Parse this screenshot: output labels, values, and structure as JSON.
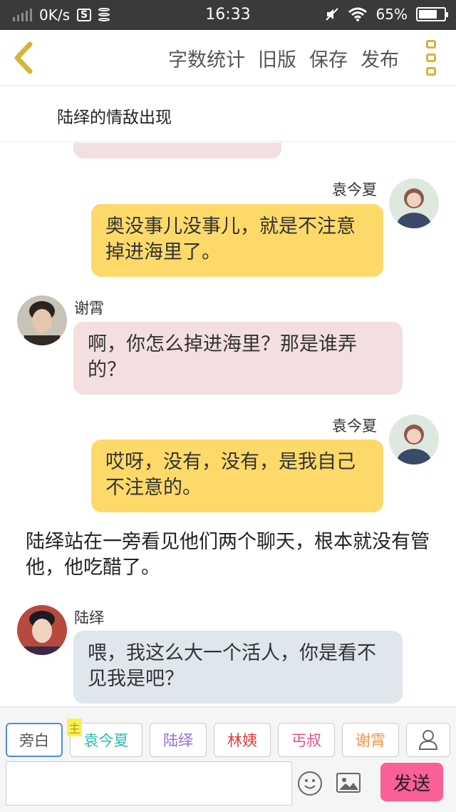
{
  "status_bar": {
    "speed": "0K/s",
    "sim_label": "S",
    "time": "16:33",
    "battery": "65%"
  },
  "header": {
    "back_icon": "back-chevron-icon",
    "actions": [
      "字数统计",
      "旧版",
      "保存",
      "发布"
    ],
    "more_icon": "more-menu-icon",
    "accent_color": "#d8b23a"
  },
  "title": "陆绎的情敌出现",
  "messages": [
    {
      "speaker": "袁今夏",
      "text": "奥没事儿没事儿，就是不注意掉进海里了。"
    },
    {
      "speaker": "谢霄",
      "text": "啊，你怎么掉进海里？那是谁弄的？"
    },
    {
      "speaker": "袁今夏",
      "text": "哎呀，没有，没有，是我自己不注意的。"
    },
    {
      "narration": "陆绎站在一旁看见他们两个聊天，根本就没有管他，他吃醋了。"
    },
    {
      "speaker": "陆绎",
      "text": "喂，我这么大一个活人，你是看不见我是吧？"
    }
  ],
  "bubble_colors": {
    "yuan": "#fdd96a",
    "xie": "#f3dfdf",
    "lu": "#dfe6ee"
  },
  "roles": [
    {
      "label": "旁白",
      "color": "#555555"
    },
    {
      "label": "袁今夏",
      "color": "#2fb9b0",
      "tag": "主"
    },
    {
      "label": "陆绎",
      "color": "#9b6ad1"
    },
    {
      "label": "林姨",
      "color": "#e23b3b"
    },
    {
      "label": "丐叔",
      "color": "#e0508a"
    },
    {
      "label": "谢霄",
      "color": "#e8954a"
    }
  ],
  "add_role_icon": "add-user-icon",
  "send_label": "发送",
  "send_color": "#fb5f97"
}
